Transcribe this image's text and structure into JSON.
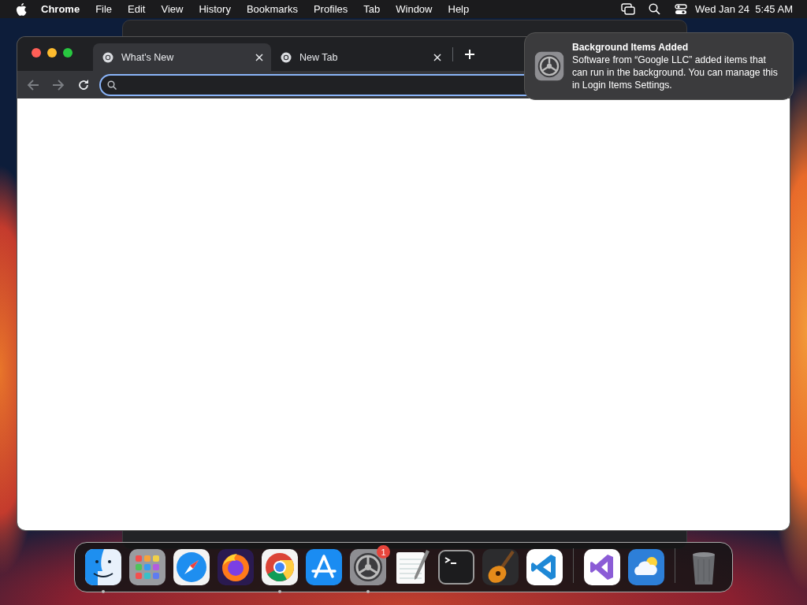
{
  "menu_bar": {
    "app_name": "Chrome",
    "menus": [
      "File",
      "Edit",
      "View",
      "History",
      "Bookmarks",
      "Profiles",
      "Tab",
      "Window",
      "Help"
    ],
    "clock": "Wed Jan 24  5:45 AM"
  },
  "browser": {
    "tabs": [
      {
        "label": "What's New",
        "selected": true
      },
      {
        "label": "New Tab",
        "selected": false
      }
    ]
  },
  "notification": {
    "title": "Background Items Added",
    "body": "Software from “Google LLC” added items that can run in the background. You can manage this in Login Items Settings."
  },
  "dock": {
    "items": [
      {
        "kind": "app",
        "running": true
      },
      {
        "kind": "app",
        "running": false
      },
      {
        "kind": "app",
        "running": false
      },
      {
        "kind": "app",
        "running": false
      },
      {
        "kind": "app",
        "running": true
      },
      {
        "kind": "app",
        "running": false
      },
      {
        "kind": "app",
        "running": true,
        "badge": "1"
      },
      {
        "kind": "app",
        "running": false
      },
      {
        "kind": "app",
        "running": false
      },
      {
        "kind": "app",
        "running": false
      },
      {
        "kind": "app",
        "running": false
      },
      {
        "kind": "separator"
      },
      {
        "kind": "app",
        "running": false
      },
      {
        "kind": "app",
        "running": false
      },
      {
        "kind": "separator"
      },
      {
        "kind": "app",
        "running": false
      }
    ]
  }
}
